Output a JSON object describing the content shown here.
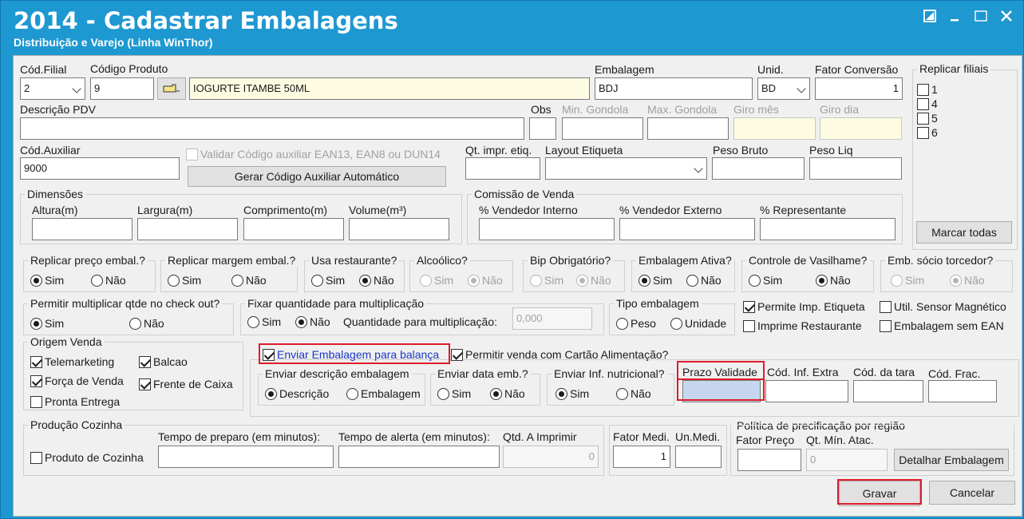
{
  "window": {
    "title": "2014 - Cadastrar Embalagens",
    "subtitle": "Distribuição e Varejo (Linha WinThor)"
  },
  "product": {
    "cod_filial_label": "Cód.Filial",
    "cod_filial_value": "2",
    "codigo_produto_label": "Código Produto",
    "codigo_produto_value": "9",
    "descricao_value": "IOGURTE ITAMBE 50ML",
    "embalagem_label": "Embalagem",
    "embalagem_value": "BDJ",
    "unid_label": "Unid.",
    "unid_value": "BD",
    "fator_conversao_label": "Fator Conversão",
    "fator_conversao_value": "1"
  },
  "replicar_filiais": {
    "label": "Replicar filiais",
    "items": [
      "1",
      "4",
      "5",
      "6"
    ],
    "marcar_todas": "Marcar todas"
  },
  "row2": {
    "descricao_pdv_label": "Descrição PDV",
    "obs_label": "Obs",
    "min_gondola_label": "Min. Gondola",
    "max_gondola_label": "Max. Gondola",
    "giro_mes_label": "Giro mês",
    "giro_dia_label": "Giro dia"
  },
  "row3": {
    "cod_auxiliar_label": "Cód.Auxiliar",
    "cod_auxiliar_value": "9000",
    "validar_label": "Validar Código auxiliar EAN13, EAN8 ou DUN14",
    "gerar_button": "Gerar Código Auxiliar Automático",
    "qt_impr_label": "Qt. impr. etiq.",
    "layout_etiqueta_label": "Layout Etiqueta",
    "peso_bruto_label": "Peso Bruto",
    "peso_liq_label": "Peso Liq"
  },
  "dimensoes": {
    "label": "Dimensões",
    "altura": "Altura(m)",
    "largura": "Largura(m)",
    "comprimento": "Comprimento(m)",
    "volume": "Volume(m³)"
  },
  "comissao": {
    "label": "Comissão de Venda",
    "vendedor_interno": "% Vendedor Interno",
    "vendedor_externo": "% Vendedor Externo",
    "representante": "% Representante"
  },
  "options": {
    "sim": "Sim",
    "nao": "Não",
    "replicar_preco": "Replicar preço embal.?",
    "replicar_margem": "Replicar margem embal.?",
    "usa_restaurante": "Usa restaurante?",
    "alcoolico": "Alcoólico?",
    "bip_obrigatorio": "Bip Obrigatório?",
    "embalagem_ativa": "Embalagem Ativa?",
    "controle_vasilhame": "Controle de Vasilhame?",
    "socio_torcedor": "Emb. sócio torcedor?"
  },
  "row5": {
    "permitir_multiplicar": "Permitir multiplicar qtde no check out?",
    "fixar_quantidade": "Fixar quantidade para multiplicação",
    "quantidade_label": "Quantidade para multiplicação:",
    "quantidade_value": "0,000",
    "tipo_embalagem": "Tipo embalagem",
    "peso": "Peso",
    "unidade": "Unidade",
    "permite_imp_etiqueta": "Permite Imp. Etiqueta",
    "util_sensor": "Util. Sensor Magnético",
    "imprime_restaurante": "Imprime Restaurante",
    "embalagem_sem_ean": "Embalagem sem EAN"
  },
  "origem_venda": {
    "label": "Origem Venda",
    "telemarketing": "Telemarketing",
    "balcao": "Balcao",
    "forca_venda": "Força de Venda",
    "frente_caixa": "Frente de Caixa",
    "pronta_entrega": "Pronta Entrega"
  },
  "balanca": {
    "enviar_balanca": "Enviar Embalagem para balança",
    "cartao_alimentacao": "Permitir venda com Cartão Alimentação?",
    "enviar_descricao": "Enviar descrição embalagem",
    "descricao": "Descrição",
    "embalagem": "Embalagem",
    "enviar_data": "Enviar data emb.?",
    "enviar_inf": "Enviar Inf. nutricional?",
    "prazo_validade": "Prazo Validade",
    "cod_inf_extra": "Cód. Inf. Extra",
    "cod_tara": "Cód. da tara",
    "cod_frac": "Cód. Frac."
  },
  "producao": {
    "label": "Produção Cozinha",
    "produto_cozinha": "Produto de Cozinha",
    "tempo_preparo": "Tempo de preparo (em minutos):",
    "tempo_alerta": "Tempo de alerta (em minutos):",
    "qtd_imprimir": "Qtd. A Imprimir",
    "qtd_value": "0",
    "fator_medi": "Fator Medi.",
    "un_medi": "Un.Medi.",
    "fator_value": "1"
  },
  "politica": {
    "label": "Política de precificação por região",
    "fator_preco": "Fator Preço",
    "qt_min_atac": "Qt. Mín. Atac.",
    "qt_value": "0",
    "detalhar": "Detalhar Embalagem"
  },
  "actions": {
    "gravar": "Gravar",
    "cancelar": "Cancelar"
  },
  "colors": {
    "titlebar": "#1e98d1",
    "highlight": "#e01b2a",
    "link_blue": "#1a37c8"
  }
}
